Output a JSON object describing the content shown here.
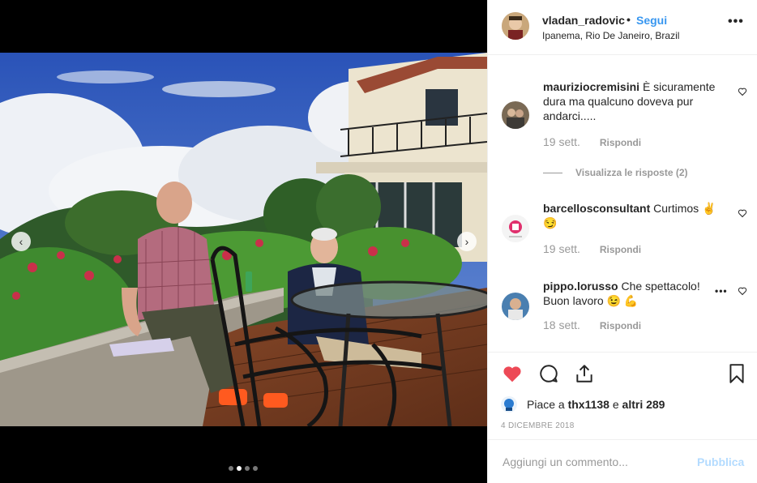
{
  "post": {
    "username": "vladan_radovic",
    "separator": "•",
    "follow_label": "Segui",
    "location": "Ipanema, Rio De Janeiro, Brazil",
    "more_label": "•••"
  },
  "media": {
    "photo_icon": "photo-of-two-men-on-terrace",
    "prev_label": "‹",
    "next_label": "›",
    "carousel_count": 4,
    "carousel_active": 1
  },
  "comments": [
    {
      "username": "mauriziocremisini",
      "text": "È sicuramente dura ma qualcuno doveva pur andarci.....",
      "time": "19 sett.",
      "reply_label": "Rispondi"
    },
    {
      "username": "barcellosconsultant",
      "text": "Curtimos ✌️ 😏",
      "time": "19 sett.",
      "reply_label": "Rispondi"
    },
    {
      "username": "pippo.lorusso",
      "text": "Che spettacolo! Buon lavoro 😉 💪",
      "time": "18 sett.",
      "reply_label": "Rispondi",
      "options_label": "•••"
    }
  ],
  "view_replies_label": "Visualizza le risposte (2)",
  "likes": {
    "prefix": "Piace a ",
    "user": "thx1138",
    "middle": " e ",
    "others": "altri 289"
  },
  "date": "4 DICEMBRE 2018",
  "add_comment": {
    "placeholder": "Aggiungi un commento...",
    "post_label": "Pubblica"
  },
  "colors": {
    "accent": "#3897f0",
    "like_red": "#ed4956",
    "muted": "#999999"
  }
}
